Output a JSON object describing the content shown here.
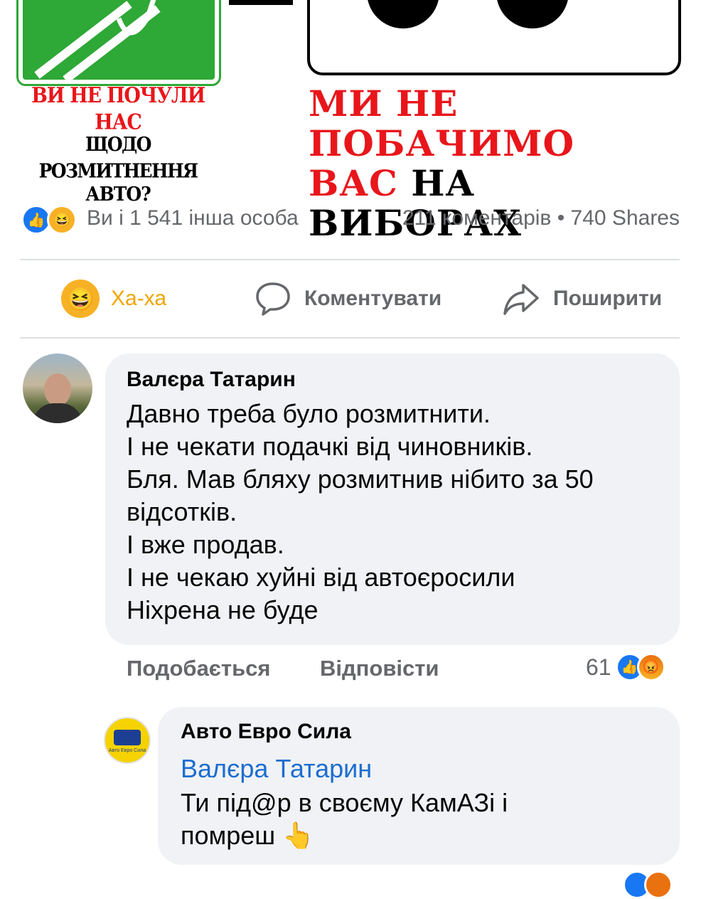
{
  "post_image": {
    "left_caption": [
      "ВИ НЕ ПОЧУЛИ НАС",
      "ЩОДО РОЗМИТНЕННЯ",
      "АВТО?"
    ],
    "right_caption_line1": "МИ НЕ ПОБАЧИМО",
    "right_caption_line2_red": "ВАС",
    "right_caption_line2_black": " НА ВИБОРАХ"
  },
  "reactions_summary": {
    "icons": [
      "like-icon",
      "haha-icon"
    ],
    "text": "Ви і 1 541 інша особа",
    "comments_shares": "211 коментарів • 740 Shares"
  },
  "actions": {
    "haha_label": "Ха-ха",
    "comment_label": "Коментувати",
    "share_label": "Поширити"
  },
  "comments": [
    {
      "author": "Валєра Татарин",
      "lines": [
        "Давно треба було розмитнити.",
        "І не чекати подачкі від чиновників.",
        "Бля. Мав бляху розмитнив нібито за 50",
        "відсотків.",
        "І вже продав.",
        "І не чекаю хуйні від автоєросили",
        "Ніхрена не буде"
      ],
      "like_label": "Подобається",
      "reply_label": "Відповісти",
      "reaction_count": "61",
      "reaction_icons": [
        "like-icon",
        "angry-icon"
      ]
    },
    {
      "author": "Авто Евро Сила",
      "avatar_text": "Авто Евро Сила",
      "mention": "Валєра Татарин",
      "lines": [
        "Ти під@р в своєму КамАЗі і",
        "помреш 👆"
      ]
    }
  ],
  "colors": {
    "facebook_blue": "#1877f2",
    "haha_yellow": "#f7b125",
    "sign_green": "#2ea836",
    "caption_red": "#e8161b",
    "muted_gray": "#65676b",
    "bubble_bg": "#f0f2f5"
  }
}
